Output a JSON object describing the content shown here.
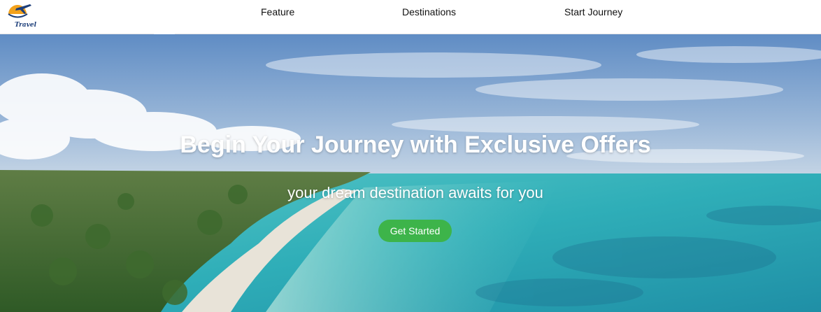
{
  "header": {
    "logo": {
      "icon": "travel-logo-icon",
      "text": "Travel"
    },
    "nav": [
      {
        "label": "Feature"
      },
      {
        "label": "Destinations"
      },
      {
        "label": "Start Journey"
      }
    ]
  },
  "hero": {
    "title": "Begin Your Journey with Exclusive Offers",
    "subtitle": "your dream destination awaits for you",
    "cta_label": "Get Started",
    "background": "aerial-beach-coastline-image"
  },
  "colors": {
    "cta": "#3db44a",
    "nav_text": "#111111",
    "hero_text": "#ffffff",
    "sky": "#6f98c8",
    "sea": "#3fbfc2"
  }
}
